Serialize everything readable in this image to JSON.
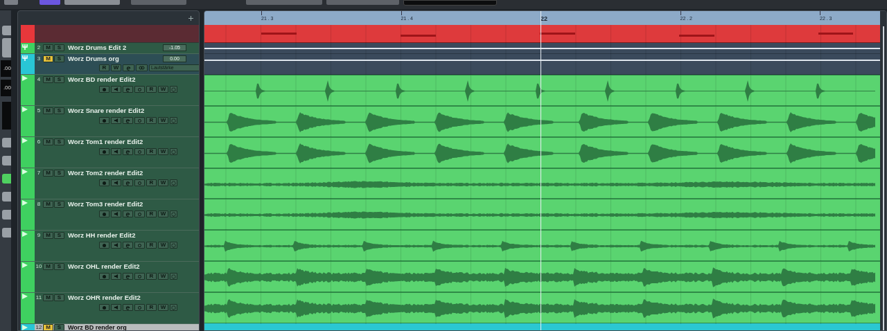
{
  "left_panel": {
    "values": [
      ".00",
      ".00"
    ]
  },
  "ruler": {
    "ticks": [
      {
        "label": "21 . 3",
        "bar": false
      },
      {
        "label": "21 . 4",
        "bar": false
      },
      {
        "label": "22",
        "bar": true
      },
      {
        "label": "22 . 2",
        "bar": false
      },
      {
        "label": "22 . 3",
        "bar": false
      }
    ]
  },
  "tracks": [
    {
      "kind": "marker",
      "color": "#e8373b"
    },
    {
      "kind": "group",
      "number": "2",
      "name": "Worz Drums Edit 2",
      "color": "#3fd060",
      "mute": {
        "label": "M",
        "on": false
      },
      "solo": {
        "label": "S"
      },
      "volume": "-1.05"
    },
    {
      "kind": "group",
      "number": "3",
      "name": "Worz Drums org",
      "color": "#29c6d6",
      "mute": {
        "label": "M",
        "on": true
      },
      "solo": {
        "label": "S"
      },
      "volume": "0.00",
      "read_label": "R",
      "write_label": "W",
      "automation": "Lautstärke"
    },
    {
      "kind": "audio",
      "number": "4",
      "name": "Worz BD render Edit2",
      "color": "#3fd060",
      "mute": {
        "label": "M",
        "on": false
      },
      "solo": {
        "label": "S"
      },
      "read_label": "R",
      "write_label": "W"
    },
    {
      "kind": "audio",
      "number": "5",
      "name": "Worz Snare render Edit2",
      "color": "#3fd060",
      "mute": {
        "label": "M",
        "on": false
      },
      "solo": {
        "label": "S"
      },
      "read_label": "R",
      "write_label": "W"
    },
    {
      "kind": "audio",
      "number": "6",
      "name": "Worz Tom1 render Edit2",
      "color": "#3fd060",
      "mute": {
        "label": "M",
        "on": false
      },
      "solo": {
        "label": "S"
      },
      "read_label": "R",
      "write_label": "W"
    },
    {
      "kind": "audio",
      "number": "7",
      "name": "Worz Tom2 render Edit2",
      "color": "#3fd060",
      "mute": {
        "label": "M",
        "on": false
      },
      "solo": {
        "label": "S"
      },
      "read_label": "R",
      "write_label": "W"
    },
    {
      "kind": "audio",
      "number": "8",
      "name": "Worz Tom3 render Edit2",
      "color": "#3fd060",
      "mute": {
        "label": "M",
        "on": false
      },
      "solo": {
        "label": "S"
      },
      "read_label": "R",
      "write_label": "W"
    },
    {
      "kind": "audio",
      "number": "9",
      "name": "Worz HH render Edit2",
      "color": "#3fd060",
      "mute": {
        "label": "M",
        "on": false
      },
      "solo": {
        "label": "S"
      },
      "read_label": "R",
      "write_label": "W"
    },
    {
      "kind": "audio",
      "number": "10",
      "name": "Worz OHL render Edit2",
      "color": "#3fd060",
      "mute": {
        "label": "M",
        "on": false
      },
      "solo": {
        "label": "S"
      },
      "read_label": "R",
      "write_label": "W"
    },
    {
      "kind": "audio",
      "number": "11",
      "name": "Worz OHR render Edit2",
      "color": "#3fd060",
      "mute": {
        "label": "M",
        "on": false
      },
      "solo": {
        "label": "S"
      },
      "read_label": "R",
      "write_label": "W"
    },
    {
      "kind": "cut",
      "number": "12",
      "name": "Worz BD render org",
      "color": "#29c6d6",
      "mute": {
        "label": "M",
        "on": true
      },
      "solo": {
        "label": "S"
      }
    }
  ]
}
